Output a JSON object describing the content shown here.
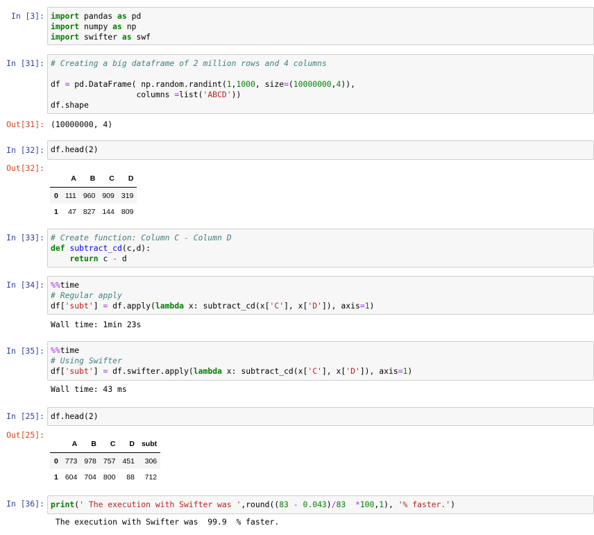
{
  "cells": {
    "c3": {
      "prompt": "In [3]:"
    },
    "c31": {
      "prompt": "In [31]:",
      "out_prompt": "Out[31]:",
      "output": "(10000000, 4)"
    },
    "c32": {
      "prompt": "In [32]:",
      "out_prompt": "Out[32]:",
      "code": "df.head(2)",
      "table": {
        "columns": [
          "",
          "A",
          "B",
          "C",
          "D"
        ],
        "rows": [
          [
            "0",
            "111",
            "960",
            "909",
            "319"
          ],
          [
            "1",
            "47",
            "827",
            "144",
            "809"
          ]
        ]
      }
    },
    "c33": {
      "prompt": "In [33]:"
    },
    "c34": {
      "prompt": "In [34]:",
      "output": "Wall time: 1min 23s"
    },
    "c35": {
      "prompt": "In [35]:",
      "output": "Wall time: 43 ms"
    },
    "c25": {
      "prompt": "In [25]:",
      "out_prompt": "Out[25]:",
      "code": "df.head(2)",
      "table": {
        "columns": [
          "",
          "A",
          "B",
          "C",
          "D",
          "subt"
        ],
        "rows": [
          [
            "0",
            "773",
            "978",
            "757",
            "451",
            "306"
          ],
          [
            "1",
            "604",
            "704",
            "800",
            "88",
            "712"
          ]
        ]
      }
    },
    "c36": {
      "prompt": "In [36]:",
      "output": " The execution with Swifter was  99.9  % faster."
    }
  },
  "code_lines": {
    "c3": [
      "import pandas as pd",
      "import numpy as np",
      "import swifter as swf"
    ],
    "c31": [
      "# Creating a big dataframe of 2 million rows and 4 columns",
      "",
      "df = pd.DataFrame( np.random.randint(1,1000, size=(10000000,4)),",
      "                  columns =list('ABCD'))",
      "df.shape"
    ],
    "c33": [
      "# Create function: Column C - Column D",
      "def subtract_cd(c,d):",
      "    return c - d"
    ],
    "c34": [
      "%%time",
      "# Regular apply",
      "df['subt'] = df.apply(lambda x: subtract_cd(x['C'], x['D']), axis=1)"
    ],
    "c35": [
      "%%time",
      "# Using Swifter",
      "df['subt'] = df.swifter.apply(lambda x: subtract_cd(x['C'], x['D']), axis=1)"
    ],
    "c36": [
      "print(' The execution with Swifter was ',round((83 - 0.043)/83  *100,1), '% faster.')"
    ]
  }
}
